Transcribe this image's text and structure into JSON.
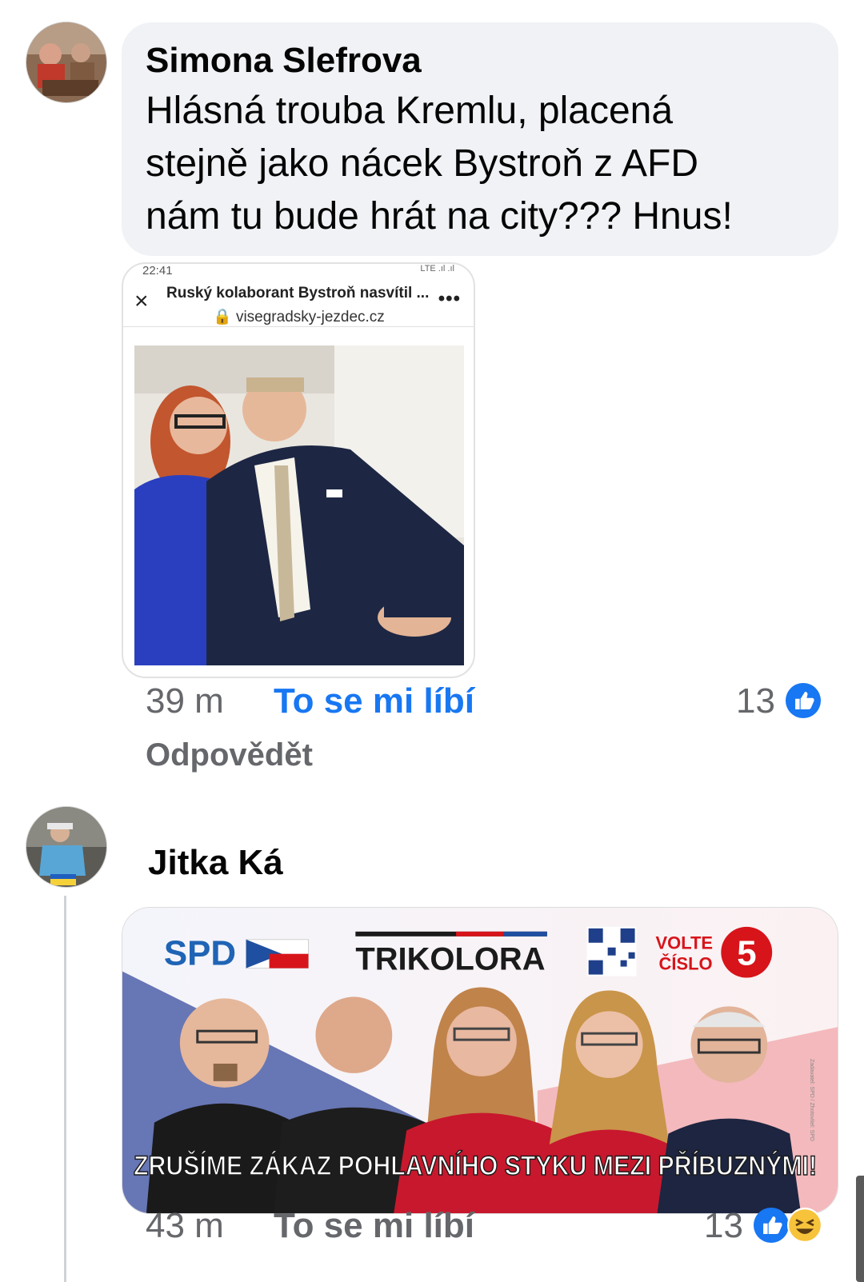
{
  "comment1": {
    "author": "Simona Slefrova",
    "text_lines": [
      "Hlásná trouba Kremlu, placená",
      "stejně jako nácek Bystroň z AFD",
      "nám tu bude hrát na city??? Hnus!"
    ],
    "attachment": {
      "status_time": "22:41",
      "status_right": "LTE .ıl .ıl",
      "page_title": "Ruský kolaborant Bystroň nasvítil ...",
      "url": "visegradsky-jezdec.cz",
      "more": "•••",
      "close": "×"
    },
    "time": "39 m",
    "like_label": "To se mi líbí",
    "like_color": "#1877f2",
    "reply_label": "Odpovědět",
    "reaction_count": "13"
  },
  "comment2": {
    "author": "Jitka Ká",
    "poster": {
      "party1": "SPD",
      "party2": "TRIKOLORA",
      "vote_line1": "VOLTE",
      "vote_line2": "ČÍSLO",
      "vote_number": "5",
      "slogan": "ZRUŠÍME ZÁKAZ POHLAVNÍHO STYKU MEZI PŘÍBUZNÝMI!",
      "side_note": "Zadavatel: SPD / Zhotovitel: SPD"
    },
    "time": "43 m",
    "like_label": "To se mi líbí",
    "like_color": "#65676b",
    "reaction_count": "13"
  },
  "icons": {
    "like": "like-icon",
    "haha": "haha-icon"
  }
}
